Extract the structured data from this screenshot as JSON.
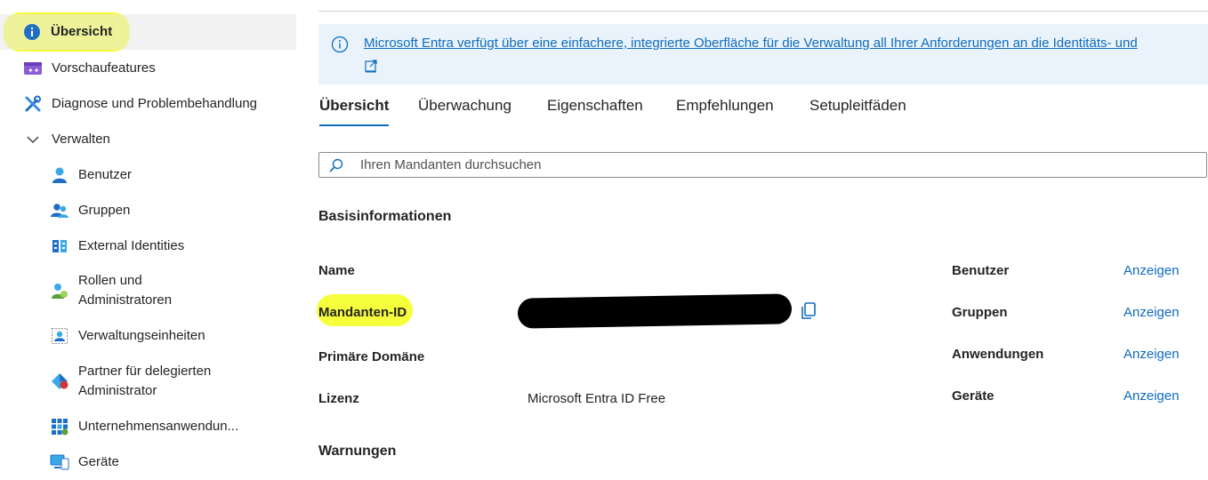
{
  "sidebar": {
    "items": [
      {
        "label": "Übersicht",
        "icon": "info-icon"
      },
      {
        "label": "Vorschaufeatures",
        "icon": "preview-features-icon"
      },
      {
        "label": "Diagnose und Problembehandlung",
        "icon": "tools-icon"
      },
      {
        "label": "Verwalten",
        "icon": "chevron-down-icon"
      },
      {
        "label": "Benutzer",
        "icon": "user-icon"
      },
      {
        "label": "Gruppen",
        "icon": "group-icon"
      },
      {
        "label": "External Identities",
        "icon": "external-identities-icon"
      },
      {
        "label": "Rollen und",
        "label2": "Administratoren",
        "icon": "roles-icon"
      },
      {
        "label": "Verwaltungseinheiten",
        "icon": "admin-units-icon"
      },
      {
        "label": "Partner für delegierten",
        "label2": "Administrator",
        "icon": "partner-icon"
      },
      {
        "label": "Unternehmensanwendun...",
        "icon": "enterprise-apps-icon"
      },
      {
        "label": "Geräte",
        "icon": "devices-icon"
      }
    ]
  },
  "banner": {
    "message": "Microsoft Entra verfügt über eine einfachere, integrierte Oberfläche für die Verwaltung all Ihrer Anforderungen an die Identitäts- und",
    "external_link_icon": "external-link-icon"
  },
  "tabs": [
    "Übersicht",
    "Überwachung",
    "Eigenschaften",
    "Empfehlungen",
    "Setupleitfäden"
  ],
  "search": {
    "placeholder": "Ihren Mandanten durchsuchen"
  },
  "basic_info": {
    "title": "Basisinformationen",
    "rows": [
      {
        "label": "Name",
        "value": ""
      },
      {
        "label": "Mandanten-ID",
        "value": ""
      },
      {
        "label": "Primäre Domäne",
        "value": ""
      },
      {
        "label": "Lizenz",
        "value": "Microsoft Entra ID Free"
      }
    ]
  },
  "stats": [
    {
      "label": "Benutzer",
      "link": "Anzeigen"
    },
    {
      "label": "Gruppen",
      "link": "Anzeigen"
    },
    {
      "label": "Anwendungen",
      "link": "Anzeigen"
    },
    {
      "label": "Geräte",
      "link": "Anzeigen"
    }
  ],
  "warnings": {
    "title": "Warnungen"
  },
  "colors": {
    "accent": "#0f6cbd",
    "highlight": "#f5ff1a",
    "banner_bg": "#eaf3fb"
  }
}
